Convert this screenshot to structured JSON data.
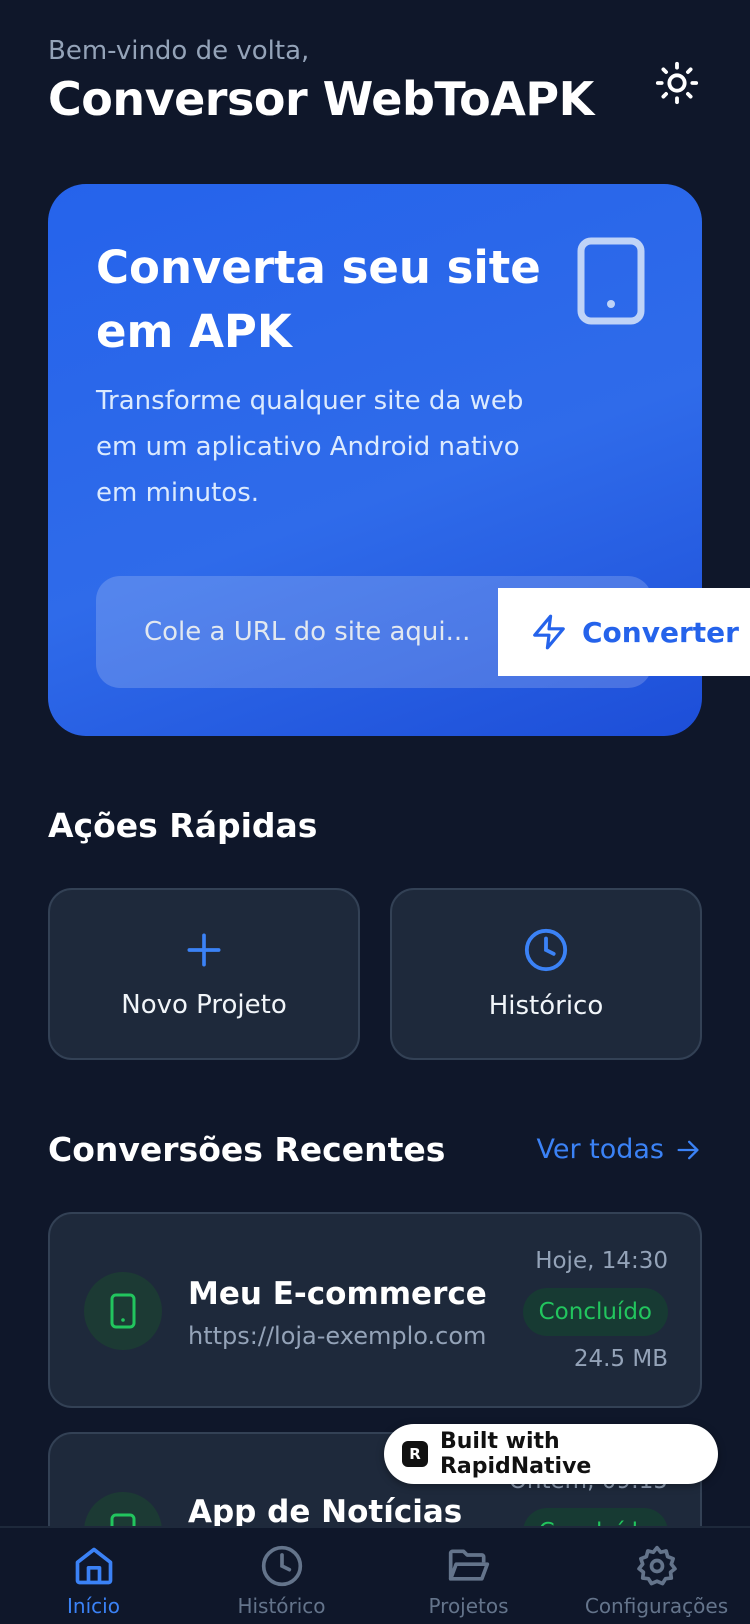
{
  "header": {
    "greeting": "Bem-vindo de volta,",
    "title": "Conversor WebToAPK",
    "theme_icon": "sun-icon"
  },
  "hero": {
    "title": "Converta seu site em APK",
    "description": "Transforme qualquer site da web em um aplicativo Android nativo em minutos.",
    "icon": "smartphone-icon",
    "url_placeholder": "Cole a URL do site aqui...",
    "convert_label": "Converter",
    "convert_icon": "zap-icon"
  },
  "quick_actions": {
    "title": "Ações Rápidas",
    "items": [
      {
        "label": "Novo Projeto",
        "icon": "plus-icon"
      },
      {
        "label": "Histórico",
        "icon": "clock-icon"
      }
    ]
  },
  "recent": {
    "title": "Conversões Recentes",
    "see_all": "Ver todas",
    "items": [
      {
        "name": "Meu E-commerce",
        "url": "https://loja-exemplo.com",
        "time": "Hoje, 14:30",
        "status": "Concluído",
        "size": "24.5 MB"
      },
      {
        "name": "App de Notícias",
        "url": "",
        "time": "Ontem, 09:15",
        "status": "Concluído",
        "size": ""
      }
    ]
  },
  "badge": {
    "label": "Built with RapidNative"
  },
  "tabs": [
    {
      "label": "Início",
      "icon": "home-icon",
      "active": true
    },
    {
      "label": "Histórico",
      "icon": "clock-icon",
      "active": false
    },
    {
      "label": "Projetos",
      "icon": "folder-open-icon",
      "active": false
    },
    {
      "label": "Configurações",
      "icon": "settings-icon",
      "active": false
    }
  ],
  "colors": {
    "background": "#0f172a",
    "card": "#1e293b",
    "accent": "#2563eb",
    "success": "#22c55e"
  }
}
